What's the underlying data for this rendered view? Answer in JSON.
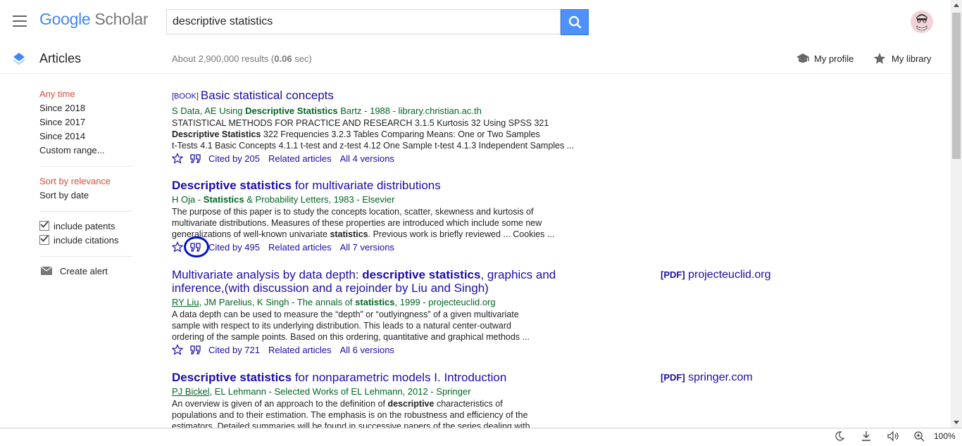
{
  "header": {
    "logo_google": "Google",
    "logo_scholar": "Scholar",
    "search_value": "descriptive statistics"
  },
  "subheader": {
    "section_title": "Articles",
    "results_prefix": "About 2,900,000 results (",
    "results_time": "0.06",
    "results_suffix": " sec)",
    "my_profile": "My profile",
    "my_library": "My library"
  },
  "sidebar": {
    "time_filters": [
      "Any time",
      "Since 2018",
      "Since 2017",
      "Since 2014",
      "Custom range..."
    ],
    "sort_options": [
      "Sort by relevance",
      "Sort by date"
    ],
    "include_patents": "include patents",
    "include_citations": "include citations",
    "create_alert": "Create alert"
  },
  "results": [
    {
      "tag": "[BOOK]",
      "title": "Basic statistical concepts",
      "authors": "S Data, AE Using Descriptive Statistics Bartz - 1988 - library.christian.ac.th",
      "snippet_lines": [
        "STATISTICAL METHODS FOR PRACTICE AND RESEARCH 3.1.5 Kurtosis 32 Using SPSS 321",
        "Descriptive Statistics 322 Frequencies 3.2.3 Tables Comparing Means: One or Two Samples",
        "t-Tests 4.1 Basic Concepts 4.1.1 t-test and z-test 4.12 One Sample t-test 4.1.3 Independent Samples ..."
      ],
      "cited_by": "Cited by 205",
      "related": "Related articles",
      "versions": "All 4 versions"
    },
    {
      "title_bold": "Descriptive statistics",
      "title_rest": " for multivariate distributions",
      "authors": "H Oja - Statistics & Probability Letters, 1983 - Elsevier",
      "snippet_lines": [
        "The purpose of this paper is to study the concepts location, scatter, skewness and kurtosis of",
        "multivariate distributions. Measures of these properties are introduced which include some new",
        "generalizations of well-known univariate statistics. Previous work is briefly reviewed ... Cookies ..."
      ],
      "cited_by": "Cited by 495",
      "related": "Related articles",
      "versions": "All 7 versions"
    },
    {
      "title_line1_a": "Multivariate analysis by data depth: ",
      "title_line1_b": "descriptive statistics",
      "title_line1_c": ", graphics and",
      "title_line2": "inference,(with discussion and a rejoinder by Liu and Singh)",
      "authors_link": "RY Liu",
      "authors_rest": ", JM Parelius, K Singh - The annals of statistics, 1999 - projecteuclid.org",
      "snippet_lines": [
        "A data depth can be used to measure the “depth” or “outlyingness” of a given multivariate",
        "sample with respect to its underlying distribution. This leads to a natural center-outward",
        "ordering of the sample points. Based on this ordering, quantitative and graphical methods ..."
      ],
      "cited_by": "Cited by 721",
      "related": "Related articles",
      "versions": "All 6 versions",
      "side_tag": "[PDF]",
      "side_source": "projecteuclid.org"
    },
    {
      "title_bold": "Descriptive statistics",
      "title_rest": " for nonparametric models I. Introduction",
      "authors_link": "PJ Bickel",
      "authors_rest": ", EL Lehmann - Selected Works of EL Lehmann, 2012 - Springer",
      "snippet_lines": [
        "An overview is given of an approach to the definition of descriptive characteristics of",
        "populations and to their estimation. The emphasis is on the robustness and efficiency of the",
        "estimators. Detailed summaries will be found in successive papers of the series dealing with"
      ],
      "side_tag": "[PDF]",
      "side_source": "springer.com"
    }
  ],
  "statusbar": {
    "zoom": "100%"
  },
  "colors": {
    "link": "#1a0dab",
    "green": "#006621",
    "active": "#dd4b39",
    "search_button": "#4d90fe",
    "annotation": "#0013cf"
  }
}
